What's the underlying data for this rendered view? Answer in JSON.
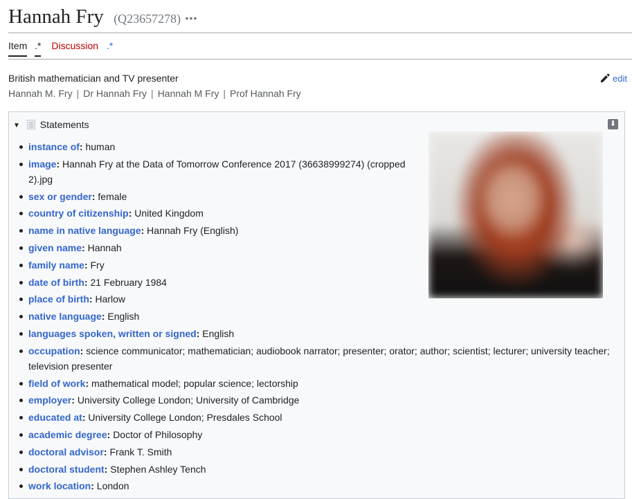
{
  "header": {
    "title": "Hannah Fry",
    "qid": "(Q23657278)",
    "more": "•••"
  },
  "tabs": [
    {
      "label": "Item",
      "active": true
    },
    {
      "label": ".*"
    },
    {
      "label": "Discussion"
    },
    {
      "label": ".*"
    }
  ],
  "description": "British mathematician and TV presenter",
  "aliases": [
    "Hannah M. Fry",
    "Dr Hannah Fry",
    "Hannah M Fry",
    "Prof Hannah Fry"
  ],
  "alias_separator": "|",
  "edit_label": "edit",
  "statements_box": {
    "toggle": "▼",
    "title": "Statements",
    "download": "⬇"
  },
  "statements": [
    {
      "prop": "instance of",
      "value": "human"
    },
    {
      "prop": "image",
      "value": "Hannah Fry at the Data of Tomorrow Conference 2017 (36638999274) (cropped 2).jpg"
    },
    {
      "prop": "sex or gender",
      "value": "female"
    },
    {
      "prop": "country of citizenship",
      "value": "United Kingdom"
    },
    {
      "prop": "name in native language",
      "value": "Hannah Fry (English)"
    },
    {
      "prop": "given name",
      "value": "Hannah"
    },
    {
      "prop": "family name",
      "value": "Fry"
    },
    {
      "prop": "date of birth",
      "value": "21 February 1984"
    },
    {
      "prop": "place of birth",
      "value": "Harlow"
    },
    {
      "prop": "native language",
      "value": "English"
    },
    {
      "prop": "languages spoken, written or signed",
      "value": "English"
    },
    {
      "prop": "occupation",
      "value": "science communicator; mathematician; audiobook narrator; presenter; orator; author; scientist; lecturer; university teacher; television presenter"
    },
    {
      "prop": "field of work",
      "value": "mathematical model; popular science; lectorship"
    },
    {
      "prop": "employer",
      "value": "University College London; University of Cambridge"
    },
    {
      "prop": "educated at",
      "value": "University College London; Presdales School"
    },
    {
      "prop": "academic degree",
      "value": "Doctor of Philosophy"
    },
    {
      "prop": "doctoral advisor",
      "value": "Frank T. Smith"
    },
    {
      "prop": "doctoral student",
      "value": "Stephen Ashley Tench"
    },
    {
      "prop": "work location",
      "value": "London"
    }
  ],
  "colors": {
    "link": "#3366cc",
    "discussion_link": "#ba0000",
    "text": "#202122",
    "muted": "#54595d",
    "box_bg": "#f8f9fa"
  },
  "icons": {
    "edit": "pencil-icon",
    "statements": "page-icon",
    "toggle": "triangle-down-icon",
    "download": "download-icon"
  }
}
